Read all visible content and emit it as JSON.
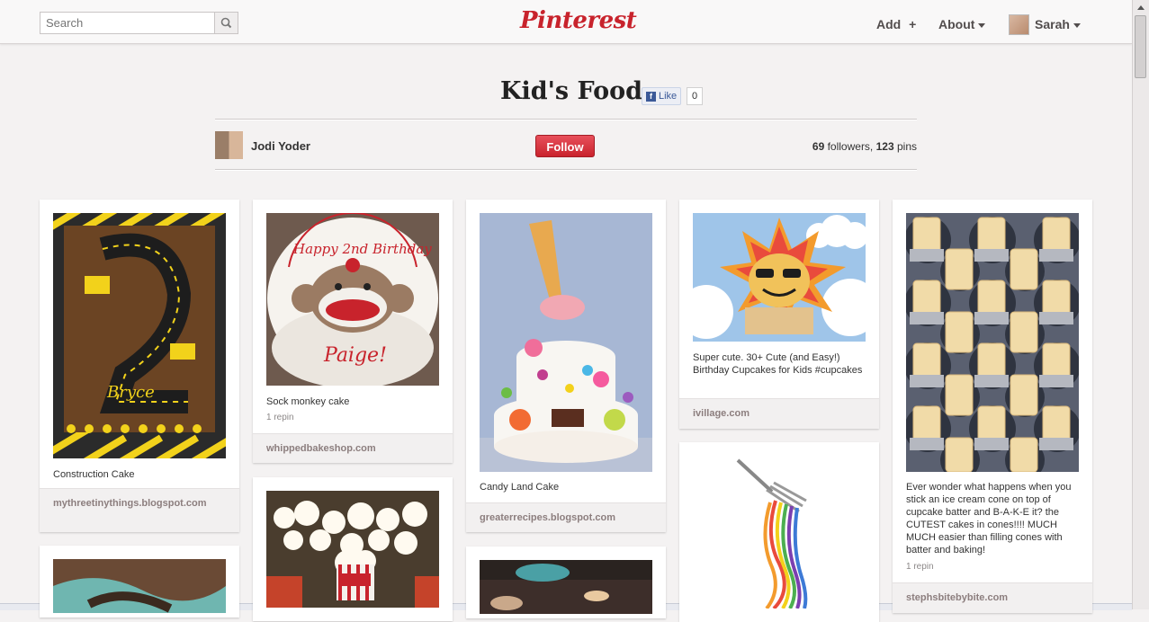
{
  "header": {
    "search_placeholder": "Search",
    "logo": "Pinterest",
    "add_label": "Add",
    "add_symbol": "+",
    "about_label": "About",
    "user_label": "Sarah"
  },
  "board": {
    "title": "Kid's Food",
    "like_label": "Like",
    "like_count": "0",
    "owner": "Jodi Yoder",
    "follow_label": "Follow",
    "followers_count": "69",
    "followers_label": " followers, ",
    "pins_count": "123",
    "pins_label": " pins"
  },
  "pins": [
    {
      "description": "Construction Cake",
      "repins": "",
      "source": "mythreetinythings.blogspot.com"
    },
    {
      "description": "Sock monkey cake",
      "repins": "1 repin",
      "source": "whippedbakeshop.com"
    },
    {
      "description": "Candy Land Cake",
      "repins": "",
      "source": "greaterrecipes.blogspot.com"
    },
    {
      "description": "Super cute. 30+ Cute (and Easy!) Birthday Cupcakes for Kids #cupcakes",
      "repins": "",
      "source": "ivillage.com"
    },
    {
      "description": "Ever wonder what happens when you stick an ice cream cone on top of cupcake batter and B-A-K-E it? the CUTEST cakes in cones!!!! MUCH MUCH easier than filling cones with batter and baking!",
      "repins": "1 repin",
      "source": "stephsbitebybite.com"
    }
  ],
  "colors": {
    "brand_red": "#c8232c",
    "follow_red": "#c9232d",
    "facebook_blue": "#3b5998"
  }
}
